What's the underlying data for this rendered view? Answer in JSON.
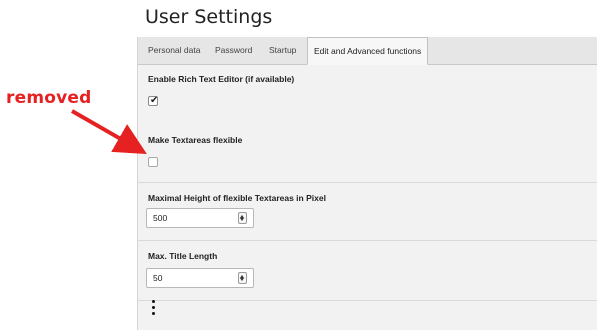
{
  "header": {
    "title": "User Settings"
  },
  "tabs": [
    {
      "label": "Personal data",
      "active": false
    },
    {
      "label": "Password",
      "active": false
    },
    {
      "label": "Startup",
      "active": false
    },
    {
      "label": "Edit and Advanced functions",
      "active": true
    }
  ],
  "settings": {
    "rich_text": {
      "label": "Enable Rich Text Editor (if available)",
      "checked": true
    },
    "flexible_textareas": {
      "label": "Make Textareas flexible",
      "checked": false
    },
    "max_height": {
      "label": "Maximal Height of flexible Textareas in Pixel",
      "value": "500"
    },
    "max_title": {
      "label": "Max. Title Length",
      "value": "50"
    }
  },
  "annotation": {
    "text": "removed",
    "color": "#e52121"
  },
  "colors": {
    "panel_bg": "#f2f2f2",
    "tabbar_bg": "#e6e6e6",
    "accent": "#e52121"
  }
}
